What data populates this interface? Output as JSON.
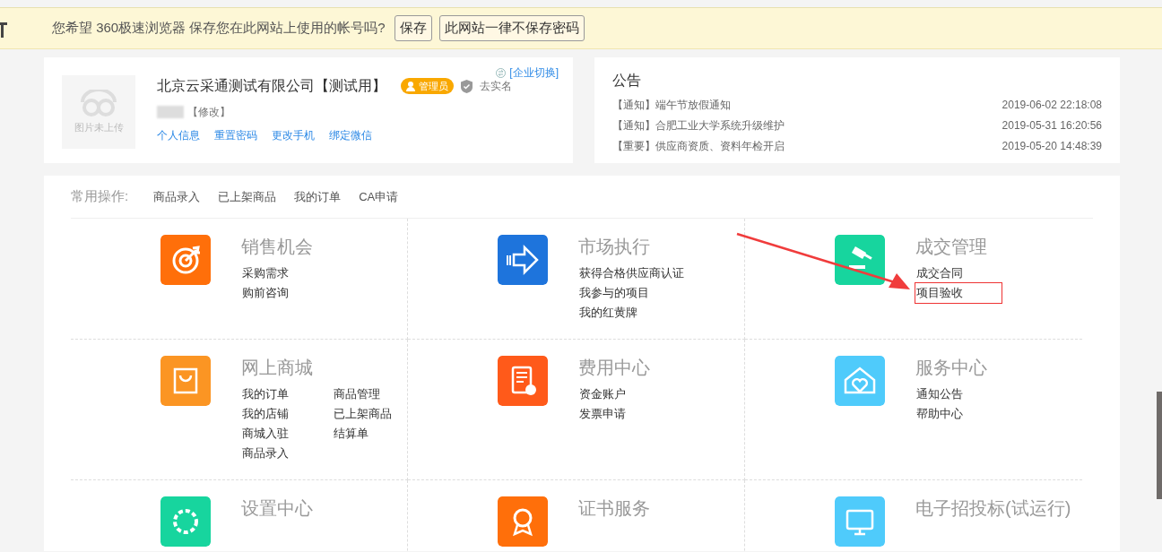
{
  "browser_bar": {
    "message": "您希望 360极速浏览器 保存您在此网站上使用的帐号吗?",
    "buttons": [
      "保存",
      "此网站一律不保存密码"
    ]
  },
  "profile": {
    "logo_text": "图片未上传",
    "company": "北京云采通测试有限公司【测试用】",
    "role_badge": "管理员",
    "verify_link": "去实名",
    "switch_link": "[企业切换]",
    "edit_link": "【修改】",
    "links": [
      "个人信息",
      "重置密码",
      "更改手机",
      "绑定微信"
    ]
  },
  "notices": {
    "title": "公告",
    "items": [
      {
        "tag": "【通知】",
        "text": "端午节放假通知",
        "time": "2019-06-02 22:18:08"
      },
      {
        "tag": "【通知】",
        "text": "合肥工业大学系统升级维护",
        "time": "2019-05-31 16:20:56"
      },
      {
        "tag": "【重要】",
        "text": "供应商资质、资料年检开启",
        "time": "2019-05-20 14:48:39"
      }
    ]
  },
  "quick_ops": {
    "label": "常用操作:",
    "items": [
      "商品录入",
      "已上架商品",
      "我的订单",
      "CA申请"
    ]
  },
  "modules": [
    {
      "title": "销售机会",
      "kind": "target",
      "color": "#ff6f0a",
      "link_columns": [
        [
          {
            "label": "采购需求",
            "highlighted": false
          },
          {
            "label": "购前咨询",
            "highlighted": false
          }
        ]
      ]
    },
    {
      "title": "市场执行",
      "kind": "arrow",
      "color": "#1e74dc",
      "link_columns": [
        [
          {
            "label": "获得合格供应商认证",
            "highlighted": false
          },
          {
            "label": "我参与的项目",
            "highlighted": false
          },
          {
            "label": "我的红黄牌",
            "highlighted": false
          }
        ]
      ]
    },
    {
      "title": "成交管理",
      "kind": "gavel",
      "color": "#17d59e",
      "link_columns": [
        [
          {
            "label": "成交合同",
            "highlighted": false
          },
          {
            "label": "项目验收",
            "highlighted": true
          }
        ]
      ]
    },
    {
      "title": "网上商城",
      "kind": "bag",
      "color": "#fb9523",
      "link_columns": [
        [
          {
            "label": "我的订单",
            "highlighted": false
          },
          {
            "label": "我的店铺",
            "highlighted": false
          },
          {
            "label": "商城入驻",
            "highlighted": false
          },
          {
            "label": "商品录入",
            "highlighted": false
          }
        ],
        [
          {
            "label": "商品管理",
            "highlighted": false
          },
          {
            "label": "已上架商品",
            "highlighted": false
          },
          {
            "label": "结算单",
            "highlighted": false
          }
        ]
      ]
    },
    {
      "title": "费用中心",
      "kind": "bill",
      "color": "#ff5a1a",
      "link_columns": [
        [
          {
            "label": "资金账户",
            "highlighted": false
          },
          {
            "label": "发票申请",
            "highlighted": false
          }
        ]
      ]
    },
    {
      "title": "服务中心",
      "kind": "house",
      "color": "#4fcbfb",
      "link_columns": [
        [
          {
            "label": "通知公告",
            "highlighted": false
          },
          {
            "label": "帮助中心",
            "highlighted": false
          }
        ]
      ]
    },
    {
      "title": "设置中心",
      "kind": "gear",
      "color": "#17d59e"
    },
    {
      "title": "证书服务",
      "kind": "cert",
      "color": "#ff6f0a"
    },
    {
      "title": "电子招投标(试运行)",
      "kind": "screen",
      "color": "#4fcbfb"
    }
  ]
}
